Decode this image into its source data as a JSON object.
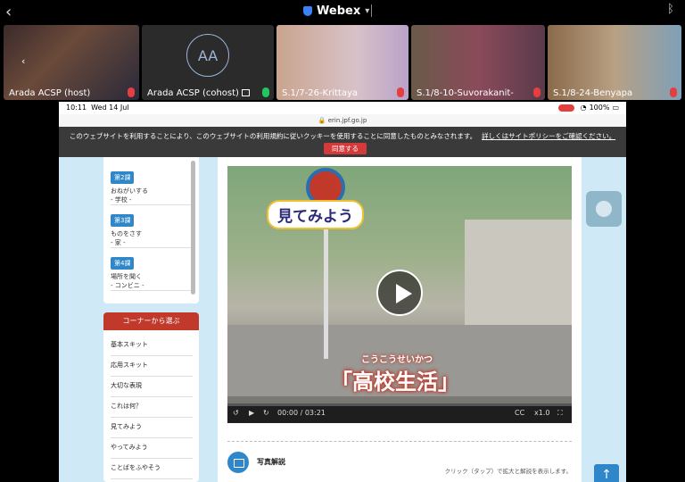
{
  "webex": {
    "app_title": "Webex",
    "participants": [
      {
        "name": "Arada ACSP (host)",
        "mic": "muted"
      },
      {
        "name": "Arada ACSP (cohost)",
        "initials": "AA",
        "mic": "on",
        "sharing": true
      },
      {
        "name": "S.1/7-26-Krittaya",
        "mic": "muted"
      },
      {
        "name": "S.1/8-10-Suvorakanit-",
        "mic": "muted"
      },
      {
        "name": "S.1/8-24-Benyapa",
        "mic": "muted"
      }
    ]
  },
  "tablet": {
    "time": "10:11",
    "date": "Wed 14 Jul",
    "battery": "100%",
    "url": "erin.jpf.go.jp"
  },
  "cookie_banner": {
    "text": "このウェブサイトを利用することにより、このウェブサイトの利用規約に従いクッキーを使用することに同意したものとみなされます。",
    "link": "詳しくはサイトポリシーをご確認ください。",
    "button": "同意する"
  },
  "lessons": [
    {
      "tag": "第2課",
      "title": "おねがいする",
      "sub": "- 学校 -"
    },
    {
      "tag": "第3課",
      "title": "ものをさす",
      "sub": "- 家 -"
    },
    {
      "tag": "第4課",
      "title": "場所を聞く",
      "sub": "- コンビニ -"
    }
  ],
  "corner": {
    "header": "コーナーから選ぶ",
    "items": [
      "基本スキット",
      "応用スキット",
      "大切な表現",
      "これは何？",
      "見てみよう",
      "やってみよう",
      "ことばをふやそう"
    ]
  },
  "video": {
    "segment_title": "見てみよう",
    "furigana": "こうこうせいかつ",
    "caption": "「高校生活」",
    "current_time": "00:00",
    "duration": "03:21",
    "cc_label": "CC",
    "speed": "x1.0",
    "progress": 0
  },
  "photo_section": {
    "title": "写真解説",
    "note": "クリック（タップ）で拡大と解説を表示します。"
  }
}
